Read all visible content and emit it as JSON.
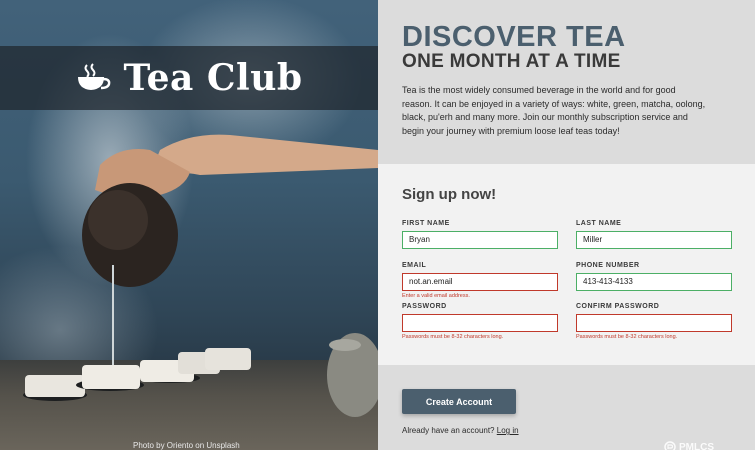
{
  "photo": {
    "brand_name": "Tea Club",
    "brand_icon": "teacup-icon",
    "credit": "Photo by Oriento on Unsplash"
  },
  "hero": {
    "title": "DISCOVER TEA",
    "subtitle": "ONE MONTH AT A TIME",
    "intro": "Tea is the most widely consumed beverage in the world and for good reason. It can be enjoyed in a variety of ways: white, green, matcha, oolong, black, pu'erh and many more. Join our monthly subscription service and begin your journey with premium loose leaf teas today!"
  },
  "form": {
    "heading": "Sign up now!",
    "first_name": {
      "label": "FIRST NAME",
      "value": "Bryan"
    },
    "last_name": {
      "label": "LAST NAME",
      "value": "Miller"
    },
    "email": {
      "label": "EMAIL",
      "value": "not.an.email",
      "error": "Enter a valid email address."
    },
    "phone": {
      "label": "PHONE NUMBER",
      "value": "413-413-4133"
    },
    "password": {
      "label": "PASSWORD",
      "value": "",
      "error": "Passwords must be 8-32 characters long."
    },
    "confirm_password": {
      "label": "CONFIRM PASSWORD",
      "value": "",
      "error": "Passwords must be 8-32 characters long."
    },
    "submit_label": "Create Account",
    "login_prompt": "Already have an account?",
    "login_link": "Log in"
  },
  "watermark": {
    "text": "PMLCS"
  },
  "colors": {
    "accent": "#4b5f6e",
    "valid_border": "#4caf66",
    "error": "#c0392b",
    "panel_bg": "#dcdcdc",
    "card_bg": "#f2f2f2"
  }
}
